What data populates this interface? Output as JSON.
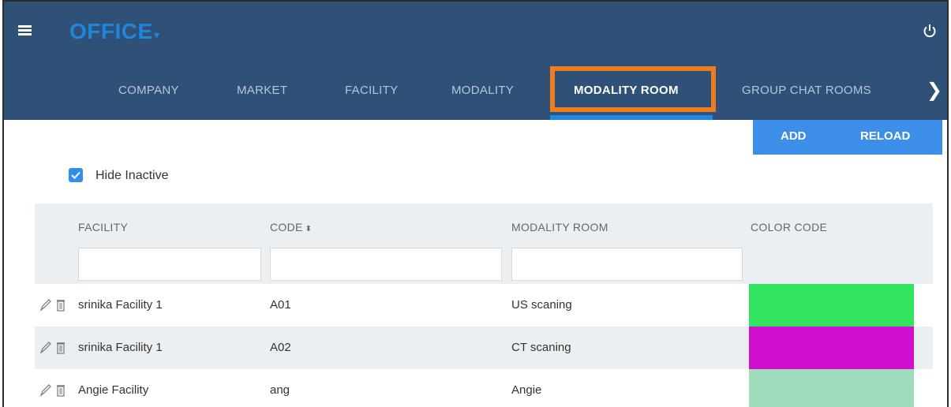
{
  "app": {
    "title": "OFFICE",
    "caret": "▾",
    "menu_icon": "hamburger-icon",
    "power_icon": "power-icon"
  },
  "tabs": [
    {
      "label": "COMPANY"
    },
    {
      "label": "MARKET"
    },
    {
      "label": "FACILITY"
    },
    {
      "label": "MODALITY"
    },
    {
      "label": "MODALITY ROOM",
      "active": true
    },
    {
      "label": "GROUP CHAT ROOMS"
    }
  ],
  "tabs_next_icon": "chevron-right-icon",
  "tabs_next_glyph": "❯",
  "toolbar": {
    "add_label": "ADD",
    "reload_label": "RELOAD"
  },
  "filter": {
    "hide_inactive_label": "Hide Inactive",
    "hide_inactive_checked": true
  },
  "table": {
    "columns": [
      "FACILITY",
      "CODE",
      "MODALITY ROOM",
      "COLOR CODE"
    ],
    "sort_glyph": "⬍",
    "filters": {
      "facility": "",
      "code": "",
      "modality_room": ""
    },
    "rows": [
      {
        "facility": "srinika Facility 1",
        "code": "A01",
        "modality_room": "US scaning",
        "color": "#31e35f"
      },
      {
        "facility": "srinika Facility 1",
        "code": "A02",
        "modality_room": "CT scaning",
        "color": "#d10fcf"
      },
      {
        "facility": "Angie Facility",
        "code": "ang",
        "modality_room": "Angie",
        "color": "#9fdcbe"
      }
    ]
  },
  "colors": {
    "header_bg": "#2f5077",
    "accent": "#1e88e5",
    "highlight": "#f07c22",
    "button_bg": "#3d8ee8"
  }
}
